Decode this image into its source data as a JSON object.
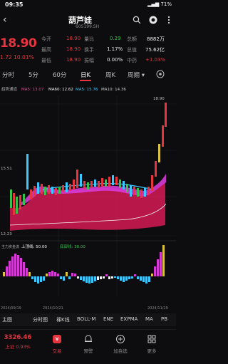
{
  "status_bar": {
    "time": "09:35",
    "battery": "71%"
  },
  "header": {
    "title": "葫芦娃",
    "code": "605199.SH",
    "back_label": "<"
  },
  "quote": {
    "price": "18.90",
    "change": "1.72",
    "change_pct": "10.01%",
    "rows": [
      {
        "l1": "今开",
        "v1": "18.90",
        "l2": "量比",
        "v2": "0.29",
        "l3": "总额",
        "v3": "8882万"
      },
      {
        "l1": "最高",
        "v1": "18.90",
        "l2": "换手",
        "v2": "1.17%",
        "l3": "总值",
        "v3": "75.62亿"
      },
      {
        "l1": "最低",
        "v1": "18.90",
        "l2": "振幅",
        "v2": "0.00%",
        "l3": "中药",
        "v3": "+1.03%"
      }
    ]
  },
  "tabs": [
    {
      "label": "分时"
    },
    {
      "label": "5分"
    },
    {
      "label": "60分"
    },
    {
      "label": "日K",
      "active": true
    },
    {
      "label": "周K"
    },
    {
      "label": "周期 ▾"
    }
  ],
  "chart": {
    "ma_legend": [
      {
        "text": "MA5: 13.07",
        "color": "#e84393"
      },
      {
        "text": "MA60: 12.62",
        "color": "#f2f2f2"
      },
      {
        "text": "MA5: 15.76",
        "color": "#3cc8ff"
      },
      {
        "text": "MA10: 14.36",
        "color": "#c9c9c9"
      }
    ],
    "price_labels": {
      "top": "18.90",
      "mid": "15.51",
      "low": "12.23"
    },
    "sub_legend": [
      {
        "text": "上顶线: 50.00",
        "color": "#f2f2f2"
      },
      {
        "text": "底部线: 30.00",
        "color": "#36c24c"
      }
    ],
    "dates": {
      "start": "2024/09/19",
      "mid": "2024/10/21",
      "end": "2024/11/29"
    }
  },
  "indicators": [
    "主图",
    "分时图",
    "裸K线",
    "BOLL-M",
    "ENE",
    "EXPMA",
    "MA",
    "PB"
  ],
  "nav": [
    {
      "label": "上证 0.93%",
      "value": "3326.46"
    },
    {
      "label": "交易"
    },
    {
      "label": "预警"
    },
    {
      "label": "加自选"
    },
    {
      "label": "更多"
    }
  ],
  "colors": {
    "up": "#e8343f",
    "down": "#36c24c",
    "accent": "#e8343f"
  }
}
